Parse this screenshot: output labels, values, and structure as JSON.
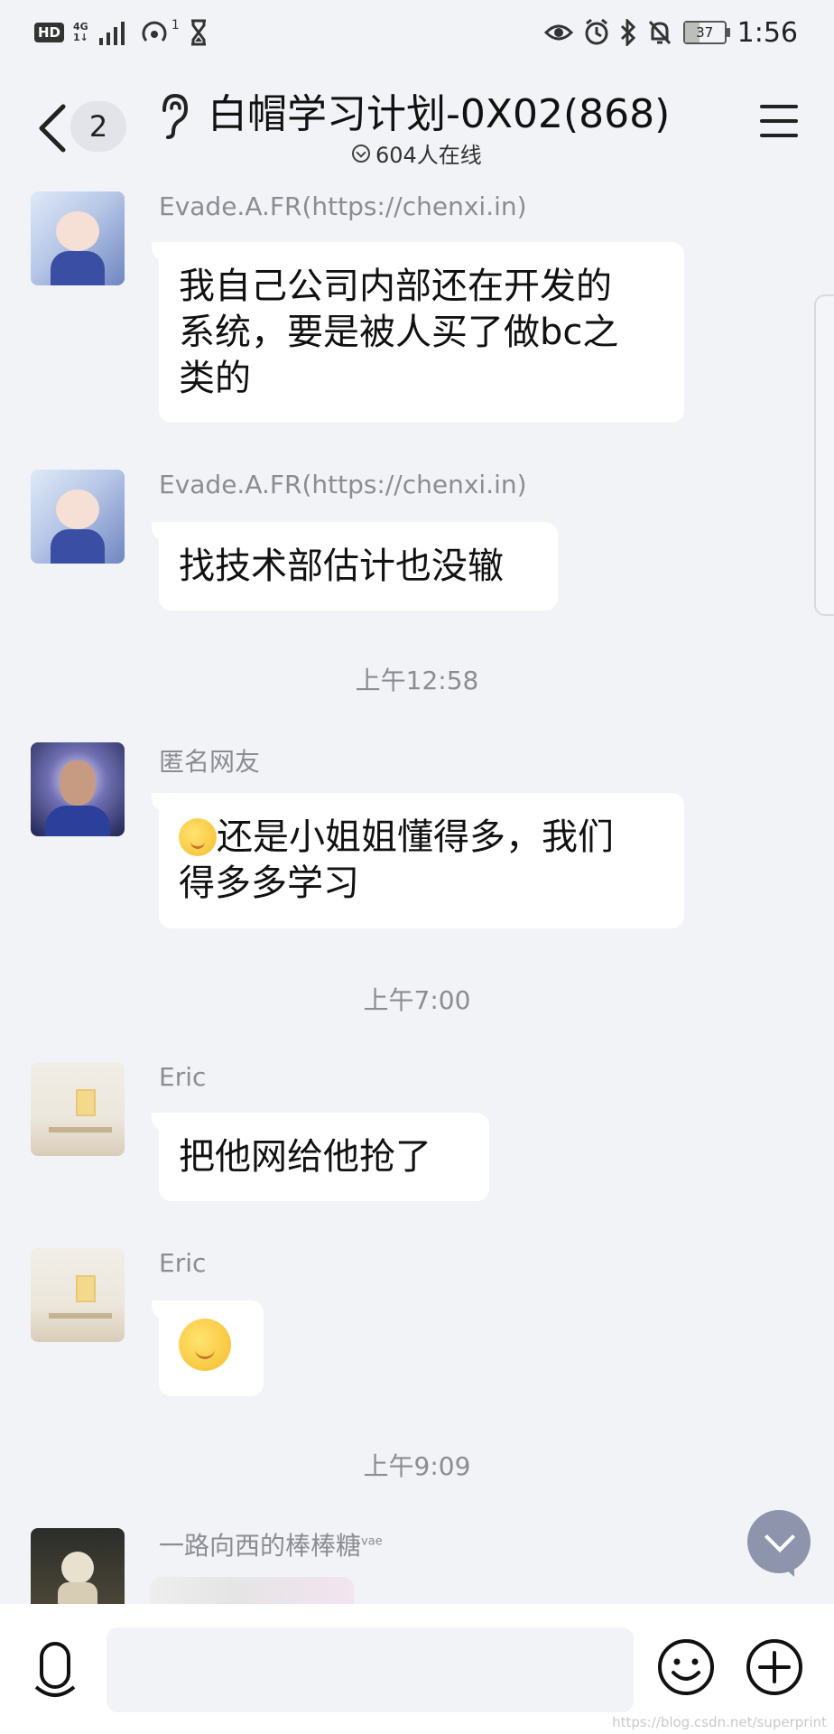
{
  "status_bar": {
    "hd": "HD",
    "network": "4G",
    "network_sub": "1↓",
    "notification_count": "1",
    "battery_level": "37",
    "time": "1:56"
  },
  "header": {
    "back_count": "2",
    "title": "白帽学习计划-0X02(868)",
    "online": "604人在线"
  },
  "messages": [
    {
      "name": "Evade.A.FR(https://chenxi.in)",
      "text_lines": [
        "我自己公司内部还在开发的",
        "系统，要是被人买了做bc之",
        "类的"
      ]
    },
    {
      "name": "Evade.A.FR(https://chenxi.in)",
      "text": "找技术部估计也没辙"
    },
    {
      "timestamp": "上午12:58"
    },
    {
      "name": "匿名网友",
      "text_lines": [
        "还是小姐姐懂得多，我们",
        "得多多学习"
      ]
    },
    {
      "timestamp": "上午7:00"
    },
    {
      "name": "Eric",
      "text": "把他网给他抢了"
    },
    {
      "name": "Eric"
    },
    {
      "timestamp": "上午9:09"
    },
    {
      "name": "一路向西的棒棒糖",
      "name_sup": "vae"
    }
  ],
  "watermark": "https://blog.csdn.net/superprint",
  "icons": [
    "back-chevron-icon",
    "ear-icon",
    "online-chevron-icon",
    "menu-icon",
    "scroll-down-icon",
    "microphone-icon",
    "smile-icon",
    "plus-icon"
  ]
}
